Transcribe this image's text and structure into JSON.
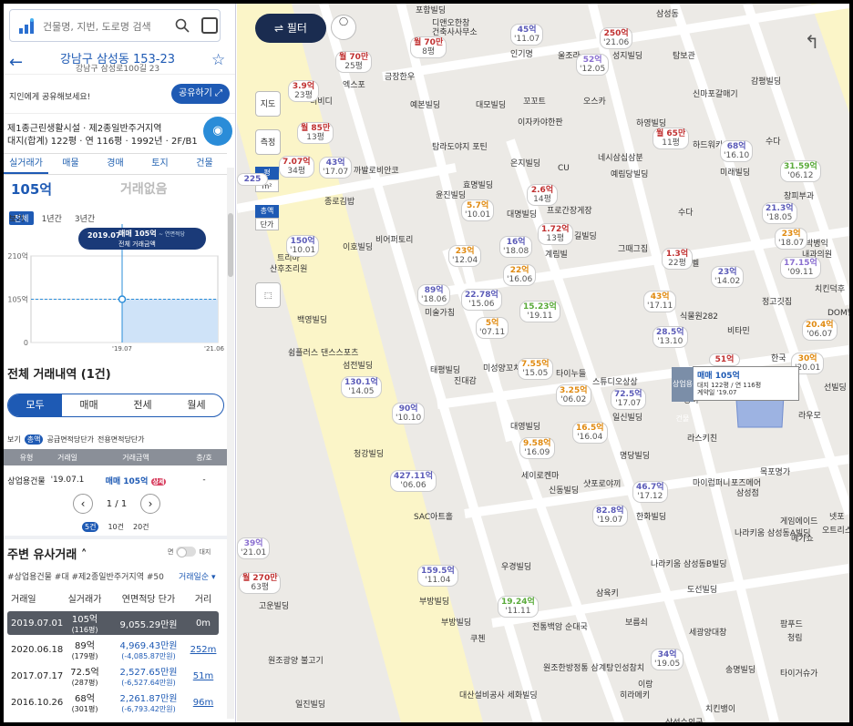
{
  "search": {
    "placeholder": "건물명, 지번, 도로명 검색"
  },
  "address": {
    "title": "강남구 삼성동 153-23",
    "road": "강남구 삼성로100길 23"
  },
  "share": {
    "text": "지인에게 공유해보세요!",
    "button": "공유하기"
  },
  "zone": {
    "line1": "제1종근린생활시설 · 제2종일반주거지역",
    "line2": "대지(합계) 122평 · 연 116평 · 1992년 · 2F/B1"
  },
  "tabs": [
    "실거래가",
    "매물",
    "경매",
    "토지",
    "건물"
  ],
  "summary": {
    "price": "105억",
    "alt": "거래없음"
  },
  "periods": {
    "label": "보기",
    "items": [
      "전체",
      "1년간",
      "3년간"
    ]
  },
  "chart_data": {
    "type": "line",
    "y_ticks": [
      "210억",
      "105억",
      "0"
    ],
    "x_ticks": [
      "'19.07",
      "'21.06"
    ],
    "ylim": [
      0,
      210
    ],
    "points": [
      {
        "x": "2019.07",
        "y": 105
      }
    ],
    "tooltip": {
      "date": "2019.07",
      "deal": "매매 105억",
      "note": "~ 연면적당",
      "sub": "전체 거래금액"
    }
  },
  "history": {
    "title": "전체 거래내역 (1건)",
    "tabs": [
      "모두",
      "매매",
      "전세",
      "월세"
    ],
    "options": {
      "lbl": "보기",
      "on": "총액",
      "a": "공급면적당단가",
      "b": "전용면적당단가"
    },
    "headers": [
      "유형",
      "거래일",
      "거래금액",
      "층/호"
    ],
    "rows": [
      {
        "type": "상업용건물",
        "date": "'19.07.1",
        "amount": "매매 105억",
        "badge": "상세",
        "floor": "-"
      }
    ],
    "pager": "1 / 1",
    "counts": [
      "5건",
      "10건",
      "20건"
    ]
  },
  "similar": {
    "title": "주변 유사거래",
    "toggle_a": "면",
    "toggle_b": "대지",
    "tags": "#상업용건물 #대 #제2종일반주거지역 #50",
    "sort": "거래일순",
    "headers": [
      "거래일",
      "실거래가",
      "연면적당 단가",
      "거리"
    ],
    "rows": [
      {
        "date": "2019.07.01",
        "price": "105억",
        "area": "(116평)",
        "unit": "9,055.29만원",
        "diff": "",
        "dist": "0m"
      },
      {
        "date": "2020.06.18",
        "price": "89억",
        "area": "(179평)",
        "unit": "4,969.43만원",
        "diff": "(-4,085.87만원)",
        "dist": "252m"
      },
      {
        "date": "2017.07.17",
        "price": "72.5억",
        "area": "(287평)",
        "unit": "2,527.65만원",
        "diff": "(-6,527.64만원)",
        "dist": "51m"
      },
      {
        "date": "2016.10.26",
        "price": "68억",
        "area": "(301평)",
        "unit": "2,261.87만원",
        "diff": "(-6,793.42만원)",
        "dist": "96m"
      }
    ]
  },
  "map": {
    "filter": "필터",
    "tools": [
      "지도",
      "측정"
    ],
    "units": [
      "평",
      "m²",
      "총액",
      "단가"
    ],
    "labels": [
      "디앤오한창",
      "건축사사무소",
      "삼성동",
      "인기명",
      "울조라",
      "성지빌딩",
      "탐보관",
      "금장한우",
      "엑스포",
      "티비디",
      "예본빌딩",
      "대모빌딩",
      "꼬꼬트",
      "이자카야한판",
      "오스카",
      "신마포갈매기",
      "감평빌딩",
      "하영빌딩",
      "하드워키",
      "수다",
      "탐라도야지 포틴",
      "온지빌딩",
      "CU",
      "네시삼십삼분",
      "예림당빌딩",
      "미래빌딩",
      "창피부과",
      "까발로비안코",
      "종로김밥",
      "효명빌딩",
      "윤진빌딩",
      "대명빌딩",
      "프로간장게장",
      "수다",
      "그때그집",
      "블루라벨",
      "이호빌딩",
      "비어퍼토리",
      "산후조리원",
      "트리마",
      "길빌딩",
      "계림빌",
      "박병익",
      "내과의원",
      "정고깃집",
      "치킨덕후",
      "식물원282",
      "비타민",
      "DOM빌",
      "미술가침",
      "백영빌딩",
      "쉼플러스 댄스스포츠",
      "섬전빌딩",
      "태평빌딩",
      "진대감",
      "미성양꼬치",
      "타이누들",
      "스튜디오상상",
      "일신빌딩",
      "당비",
      "라스키친",
      "한국",
      "선빌딩",
      "라우모",
      "청강빌딩",
      "대영빌딩",
      "세이로켄마",
      "신동빌딩",
      "샷포로야끼",
      "명당빌딩",
      "목포명가",
      "마이럽퍼니",
      "포즈메어",
      "삼성점",
      "SAC아트홀",
      "한화빌딩",
      "나라키움 삼성동B빌딩",
      "게임에이드",
      "넷포",
      "오트리스",
      "나라키움 삼성동A빌딩",
      "메가쇼",
      "우경빌딩",
      "부방빌딩",
      "부방빌딩",
      "쿠첸",
      "삼육키",
      "도선빌딩",
      "보름쇠",
      "세광양대창",
      "팜푸드",
      "청림",
      "전통백암 순대국",
      "원조한방정통 삼계탕",
      "인성참치",
      "이랑",
      "송명빌딩",
      "타이거슈가",
      "원조광양 불고기",
      "일진빌딩",
      "대산설비공사 세화빌딩",
      "히라메키",
      "치킨뱅이",
      "삼성수의국",
      "고운빌딩",
      "포함빌딩"
    ],
    "popup": {
      "tag": "상업용건물",
      "deal": "매매 105억",
      "info": "대지 122평 / 연 116평",
      "date": "계약일 '19.07"
    }
  },
  "markers": [
    {
      "price": "45억",
      "date": "'11.07",
      "c": "bl"
    },
    {
      "price": "250억",
      "date": "'21.06",
      "c": "rd"
    },
    {
      "price": "월 70만",
      "date": "8평",
      "c": "rd"
    },
    {
      "price": "월 70만",
      "date": "25평",
      "c": "rd"
    },
    {
      "price": "52억",
      "date": "'12.05",
      "c": "vi"
    },
    {
      "price": "3.9억",
      "date": "23평",
      "c": "rd"
    },
    {
      "price": "월 85만",
      "date": "13평",
      "c": "rd"
    },
    {
      "price": "월 65만",
      "date": "11평",
      "c": "rd"
    },
    {
      "price": "68억",
      "date": "'16.10",
      "c": "bl"
    },
    {
      "price": "7.07억",
      "date": "34평",
      "c": "rd"
    },
    {
      "price": "43억",
      "date": "'17.07",
      "c": "bl"
    },
    {
      "price": "31.59억",
      "date": "'06.12",
      "c": "gr"
    },
    {
      "price": "2.6억",
      "date": "14평",
      "c": "rd"
    },
    {
      "price": "5.7억",
      "date": "'10.01",
      "c": "or"
    },
    {
      "price": "21.3억",
      "date": "'18.05",
      "c": "bl"
    },
    {
      "price": "1.72억",
      "date": "13평",
      "c": "rd"
    },
    {
      "price": "150억",
      "date": "'10.01",
      "c": "bl"
    },
    {
      "price": "23억",
      "date": "'12.04",
      "c": "or"
    },
    {
      "price": "16억",
      "date": "'18.08",
      "c": "bl"
    },
    {
      "price": "1.3억",
      "date": "22평",
      "c": "rd"
    },
    {
      "price": "23억",
      "date": "'14.02",
      "c": "bl"
    },
    {
      "price": "23억",
      "date": "'18.07",
      "c": "or"
    },
    {
      "price": "22억",
      "date": "'16.06",
      "c": "or"
    },
    {
      "price": "17.15억",
      "date": "'09.11",
      "c": "vi"
    },
    {
      "price": "89억",
      "date": "'18.06",
      "c": "bl"
    },
    {
      "price": "22.78억",
      "date": "'15.06",
      "c": "bl"
    },
    {
      "price": "15.23억",
      "date": "'19.11",
      "c": "gr"
    },
    {
      "price": "43억",
      "date": "'17.11",
      "c": "or"
    },
    {
      "price": "5억",
      "date": "'07.11",
      "c": "or"
    },
    {
      "price": "28.5억",
      "date": "'13.10",
      "c": "bl"
    },
    {
      "price": "20.4억",
      "date": "'06.07",
      "c": "or"
    },
    {
      "price": "7.55억",
      "date": "'15.05",
      "c": "or"
    },
    {
      "price": "51억",
      "date": "",
      "c": "rd"
    },
    {
      "price": "30억",
      "date": "'20.01",
      "c": "or"
    },
    {
      "price": "130.1억",
      "date": "'14.05",
      "c": "bl"
    },
    {
      "price": "3.25억",
      "date": "'06.02",
      "c": "or"
    },
    {
      "price": "72.5억",
      "date": "'17.07",
      "c": "bl"
    },
    {
      "price": "90억",
      "date": "'10.10",
      "c": "bl"
    },
    {
      "price": "16.5억",
      "date": "'16.04",
      "c": "or"
    },
    {
      "price": "9.58억",
      "date": "'16.09",
      "c": "or"
    },
    {
      "price": "427.11억",
      "date": "'06.06",
      "c": "bl"
    },
    {
      "price": "46.7억",
      "date": "'17.12",
      "c": "bl"
    },
    {
      "price": "82.8억",
      "date": "'19.07",
      "c": "bl"
    },
    {
      "price": "39억",
      "date": "'21.01",
      "c": "vi"
    },
    {
      "price": "월 270만",
      "date": "63평",
      "c": "rd"
    },
    {
      "price": "159.5억",
      "date": "'11.04",
      "c": "bl"
    },
    {
      "price": "19.24억",
      "date": "'11.11",
      "c": "gr"
    },
    {
      "price": "34억",
      "date": "'19.05",
      "c": "bl"
    },
    {
      "price": "225",
      "date": "",
      "c": "bl"
    }
  ]
}
